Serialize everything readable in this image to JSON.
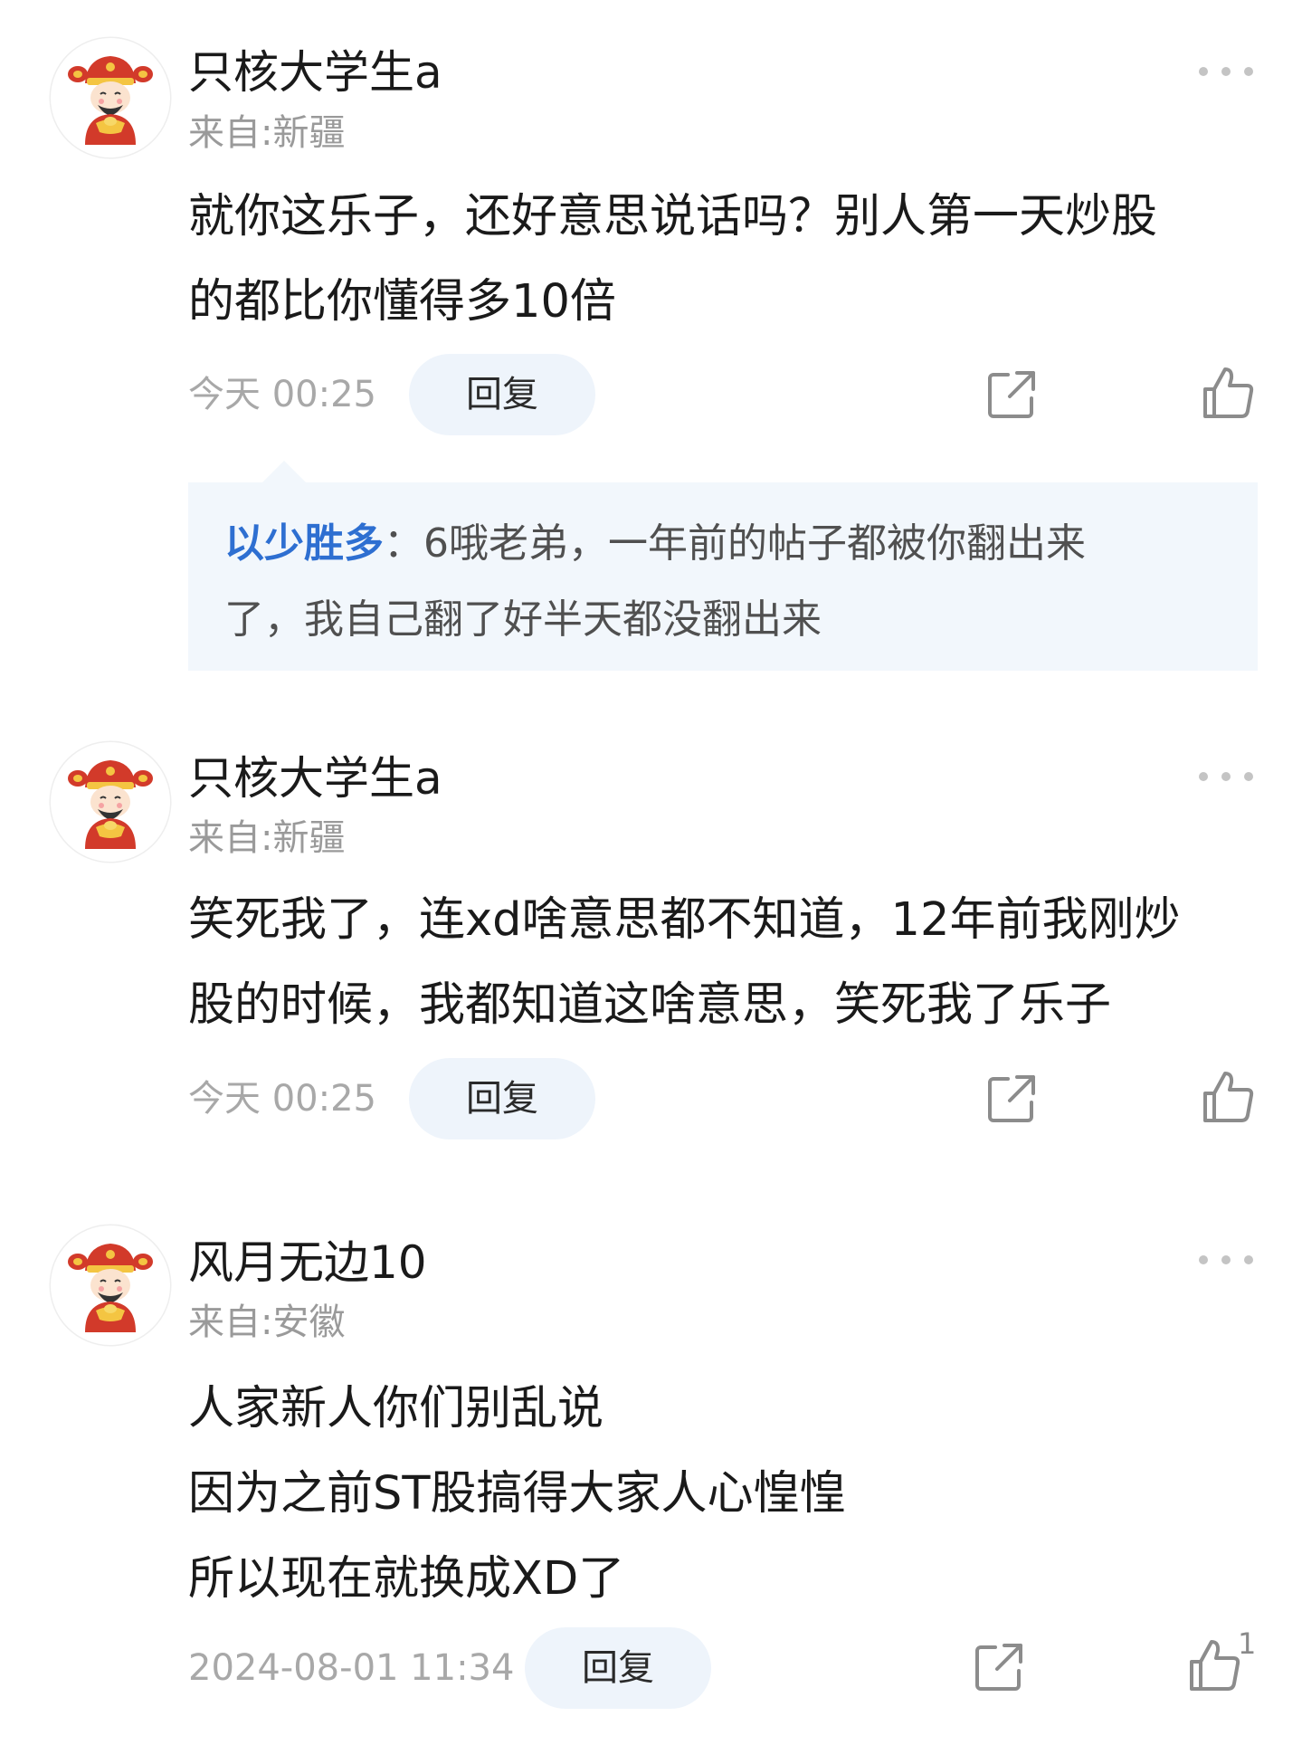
{
  "comments": [
    {
      "username": "只核大学生a",
      "location": "来自:新疆",
      "body_lines": [
        "就你这乐子，还好意思说话吗？别人第一天炒股",
        "的都比你懂得多10倍"
      ],
      "timestamp": "今天 00:25",
      "reply_label": "回复",
      "reply": {
        "author": "以少胜多",
        "separator": "：",
        "lines": [
          "6哦老弟，一年前的帖子都被你翻出来",
          "了，我自己翻了好半天都没翻出来"
        ]
      }
    },
    {
      "username": "只核大学生a",
      "location": "来自:新疆",
      "body_lines": [
        "笑死我了，连xd啥意思都不知道，12年前我刚炒",
        "股的时候，我都知道这啥意思，笑死我了乐子"
      ],
      "timestamp": "今天 00:25",
      "reply_label": "回复"
    },
    {
      "username": "风月无边10",
      "location": "来自:安徽",
      "body_lines": [
        "人家新人你们别乱说",
        "因为之前ST股搞得大家人心惶惶",
        "所以现在就换成XD了"
      ],
      "timestamp": "2024-08-01 11:34",
      "reply_label": "回复",
      "like_count": "1"
    }
  ],
  "icons": {
    "avatar": "caishen-avatar-icon",
    "more": "more-dots-icon",
    "share": "share-icon",
    "like": "thumbs-up-icon"
  },
  "colors": {
    "reply_author": "#2e6fd1",
    "reply_bg": "#f2f7fc",
    "reply_button_bg": "#eef4fb",
    "meta_text": "#9a9a9a"
  }
}
